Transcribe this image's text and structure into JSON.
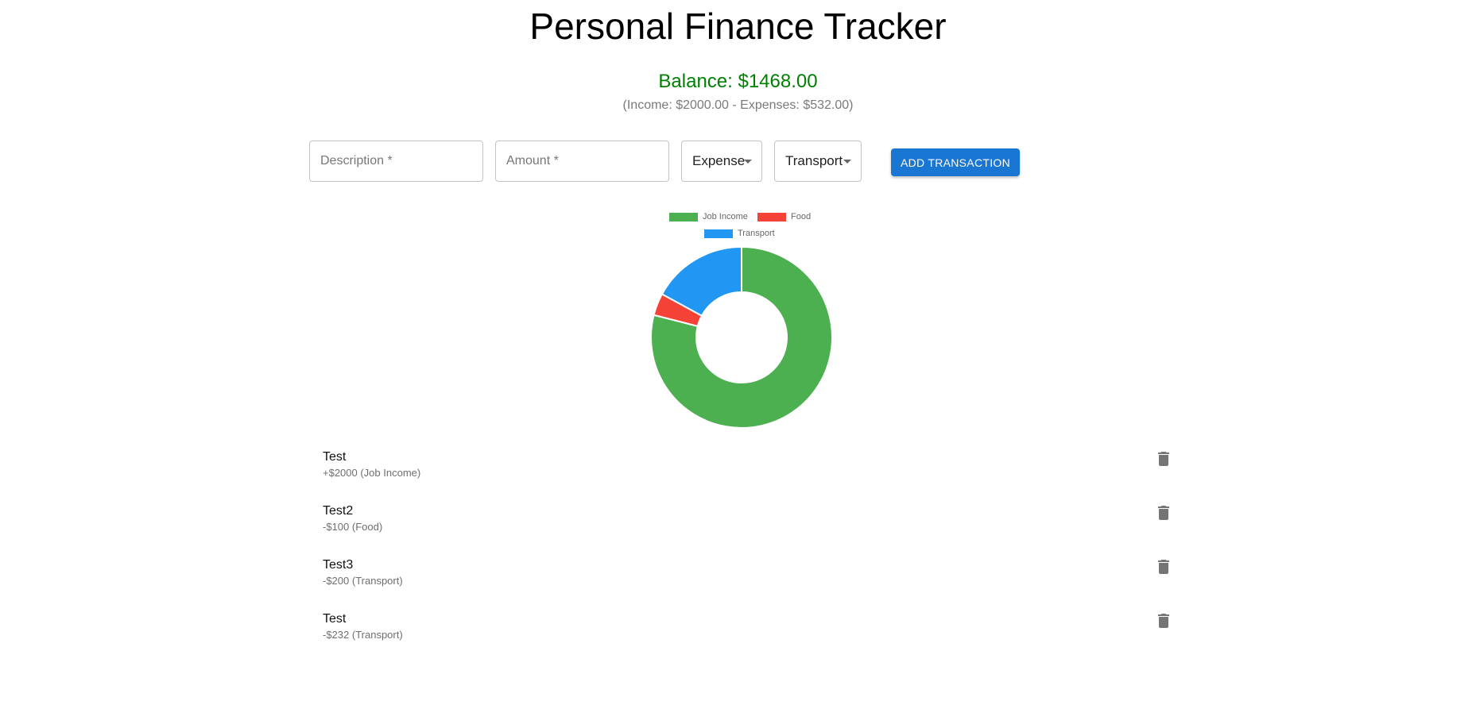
{
  "header": {
    "title": "Personal Finance Tracker"
  },
  "summary": {
    "balance": "Balance: $1468.00",
    "breakdown": "(Income: $2000.00 - Expenses: $532.00)",
    "balance_color": "#008000"
  },
  "form": {
    "description_placeholder": "Description *",
    "amount_placeholder": "Amount *",
    "type_value": "Expense",
    "category_value": "Transport",
    "add_label": "ADD TRANSACTION",
    "button_color": "#1976d2"
  },
  "chart_data": {
    "type": "pie",
    "categories": [
      "Job Income",
      "Food",
      "Transport"
    ],
    "values": [
      2000,
      100,
      432
    ],
    "colors": [
      "#4caf50",
      "#f44336",
      "#2196f3"
    ],
    "legend": "top"
  },
  "transactions": [
    {
      "description": "Test",
      "amount": "+$2000 (Job Income)",
      "icon": "trash-icon"
    },
    {
      "description": "Test2",
      "amount": "-$100 (Food)",
      "icon": "trash-icon"
    },
    {
      "description": "Test3",
      "amount": "-$200 (Transport)",
      "icon": "trash-icon"
    },
    {
      "description": "Test",
      "amount": "-$232 (Transport)",
      "icon": "trash-icon"
    }
  ]
}
